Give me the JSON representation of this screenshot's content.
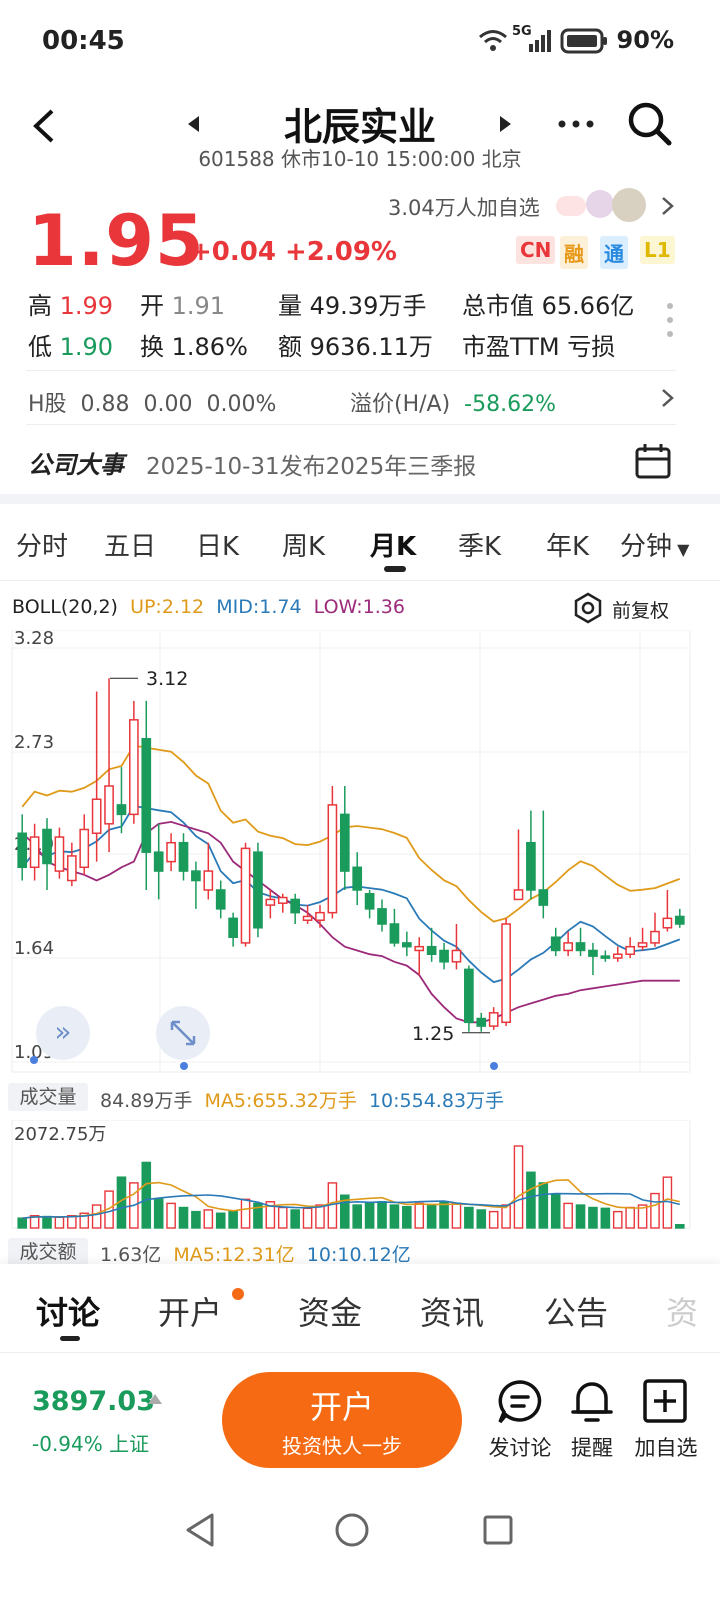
{
  "status": {
    "time": "00:45",
    "network": "5G",
    "battery": "90%"
  },
  "header": {
    "title": "北辰实业",
    "code": "601588",
    "market_status": "休市10-10 15:00:00 北京"
  },
  "quote": {
    "price": "1.95",
    "change": "+0.04",
    "change_pct": "+2.09%",
    "watchers": "3.04万人加自选",
    "tags": [
      "CN",
      "融",
      "通",
      "L1"
    ],
    "high_label": "高",
    "high": "1.99",
    "open_label": "开",
    "open": "1.91",
    "volume_label": "量",
    "volume": "49.39万手",
    "mcap_label": "总市值",
    "mcap": "65.66亿",
    "low_label": "低",
    "low": "1.90",
    "turnover_label": "换",
    "turnover": "1.86%",
    "amount_label": "额",
    "amount": "9636.11万",
    "pe_label": "市盈TTM",
    "pe": "亏损"
  },
  "hshare": {
    "label": "H股",
    "price": "0.88",
    "change": "0.00",
    "pct": "0.00%",
    "premium_label": "溢价(H/A)",
    "premium": "-58.62%"
  },
  "event": {
    "label": "公司大事",
    "text": "2025-10-31发布2025年三季报"
  },
  "period_tabs": [
    "分时",
    "五日",
    "日K",
    "周K",
    "月K",
    "季K",
    "年K",
    "分钟"
  ],
  "active_period": "月K",
  "indicator": {
    "name": "BOLL(20,2)",
    "up": "UP:2.12",
    "mid": "MID:1.74",
    "low": "LOW:1.36",
    "adjust": "前复权"
  },
  "colors": {
    "up": "#e8363b",
    "down": "#1a9b5c",
    "upper": "#e09a1a",
    "mid": "#2a7ab8",
    "lower": "#9b2a7a",
    "accent": "#f56a13"
  },
  "chart_data": {
    "type": "candlestick",
    "y_ticks": [
      "3.28",
      "2.73",
      "2.19",
      "1.64",
      "1.09"
    ],
    "ylim": [
      1.09,
      3.28
    ],
    "max_label": "3.12",
    "min_label": "1.25",
    "candles": [
      {
        "o": 2.3,
        "c": 2.12,
        "h": 2.4,
        "l": 2.05
      },
      {
        "o": 2.12,
        "c": 2.28,
        "h": 2.35,
        "l": 2.05
      },
      {
        "o": 2.32,
        "c": 2.14,
        "h": 2.38,
        "l": 2.0
      },
      {
        "o": 2.1,
        "c": 2.28,
        "h": 2.33,
        "l": 2.06
      },
      {
        "o": 2.05,
        "c": 2.18,
        "h": 2.25,
        "l": 2.02
      },
      {
        "o": 2.12,
        "c": 2.32,
        "h": 2.4,
        "l": 2.08
      },
      {
        "o": 2.3,
        "c": 2.48,
        "h": 3.05,
        "l": 2.15
      },
      {
        "o": 2.35,
        "c": 2.55,
        "h": 3.12,
        "l": 2.2
      },
      {
        "o": 2.45,
        "c": 2.4,
        "h": 2.65,
        "l": 2.3
      },
      {
        "o": 2.4,
        "c": 2.9,
        "h": 3.0,
        "l": 2.35
      },
      {
        "o": 2.8,
        "c": 2.2,
        "h": 3.0,
        "l": 2.0
      },
      {
        "o": 2.2,
        "c": 2.1,
        "h": 2.35,
        "l": 1.95
      },
      {
        "o": 2.15,
        "c": 2.25,
        "h": 2.3,
        "l": 2.1
      },
      {
        "o": 2.25,
        "c": 2.1,
        "h": 2.3,
        "l": 2.05
      },
      {
        "o": 2.1,
        "c": 2.05,
        "h": 2.15,
        "l": 1.9
      },
      {
        "o": 2.0,
        "c": 2.1,
        "h": 2.25,
        "l": 1.95
      },
      {
        "o": 2.0,
        "c": 1.9,
        "h": 2.05,
        "l": 1.85
      },
      {
        "o": 1.85,
        "c": 1.75,
        "h": 1.88,
        "l": 1.7
      },
      {
        "o": 1.72,
        "c": 2.22,
        "h": 2.25,
        "l": 1.7
      },
      {
        "o": 2.2,
        "c": 1.8,
        "h": 2.25,
        "l": 1.75
      },
      {
        "o": 1.92,
        "c": 1.95,
        "h": 2.0,
        "l": 1.85
      },
      {
        "o": 1.93,
        "c": 1.96,
        "h": 1.98,
        "l": 1.88
      },
      {
        "o": 1.95,
        "c": 1.88,
        "h": 1.98,
        "l": 1.82
      },
      {
        "o": 1.84,
        "c": 1.86,
        "h": 1.92,
        "l": 1.82
      },
      {
        "o": 1.84,
        "c": 1.88,
        "h": 1.92,
        "l": 1.8
      },
      {
        "o": 1.88,
        "c": 2.45,
        "h": 2.55,
        "l": 1.85
      },
      {
        "o": 2.4,
        "c": 2.1,
        "h": 2.55,
        "l": 2.0
      },
      {
        "o": 2.12,
        "c": 2.0,
        "h": 2.2,
        "l": 1.92
      },
      {
        "o": 1.98,
        "c": 1.9,
        "h": 2.0,
        "l": 1.85
      },
      {
        "o": 1.9,
        "c": 1.82,
        "h": 1.95,
        "l": 1.78
      },
      {
        "o": 1.82,
        "c": 1.72,
        "h": 1.9,
        "l": 1.7
      },
      {
        "o": 1.72,
        "c": 1.7,
        "h": 1.78,
        "l": 1.65
      },
      {
        "o": 1.68,
        "c": 1.7,
        "h": 1.75,
        "l": 1.55
      },
      {
        "o": 1.7,
        "c": 1.66,
        "h": 1.8,
        "l": 1.62
      },
      {
        "o": 1.68,
        "c": 1.62,
        "h": 1.72,
        "l": 1.58
      },
      {
        "o": 1.62,
        "c": 1.68,
        "h": 1.82,
        "l": 1.58
      },
      {
        "o": 1.58,
        "c": 1.3,
        "h": 1.6,
        "l": 1.25
      },
      {
        "o": 1.32,
        "c": 1.28,
        "h": 1.35,
        "l": 1.25
      },
      {
        "o": 1.28,
        "c": 1.35,
        "h": 1.38,
        "l": 1.26
      },
      {
        "o": 1.3,
        "c": 1.82,
        "h": 1.85,
        "l": 1.28
      },
      {
        "o": 1.95,
        "c": 2.0,
        "h": 2.32,
        "l": 1.95
      },
      {
        "o": 2.25,
        "c": 2.0,
        "h": 2.42,
        "l": 1.95
      },
      {
        "o": 2.0,
        "c": 1.92,
        "h": 2.42,
        "l": 1.85
      },
      {
        "o": 1.75,
        "c": 1.68,
        "h": 1.8,
        "l": 1.65
      },
      {
        "o": 1.68,
        "c": 1.72,
        "h": 1.78,
        "l": 1.65
      },
      {
        "o": 1.72,
        "c": 1.68,
        "h": 1.8,
        "l": 1.65
      },
      {
        "o": 1.68,
        "c": 1.65,
        "h": 1.72,
        "l": 1.55
      },
      {
        "o": 1.65,
        "c": 1.64,
        "h": 1.68,
        "l": 1.62
      },
      {
        "o": 1.64,
        "c": 1.66,
        "h": 1.7,
        "l": 1.62
      },
      {
        "o": 1.66,
        "c": 1.7,
        "h": 1.75,
        "l": 1.64
      },
      {
        "o": 1.7,
        "c": 1.72,
        "h": 1.8,
        "l": 1.68
      },
      {
        "o": 1.72,
        "c": 1.78,
        "h": 1.88,
        "l": 1.7
      },
      {
        "o": 1.8,
        "c": 1.85,
        "h": 2.0,
        "l": 1.78
      },
      {
        "o": 1.86,
        "c": 1.82,
        "h": 1.9,
        "l": 1.8
      }
    ],
    "upper": [
      2.3,
      2.24,
      2.15,
      2.12,
      2.1,
      2.08,
      2.05,
      2.08,
      2.12,
      2.15,
      2.3,
      2.35,
      2.36,
      2.34,
      2.32,
      2.3,
      2.25,
      2.15,
      2.1,
      2.05,
      2.0,
      1.95,
      1.92,
      1.88,
      1.82,
      1.75,
      1.7,
      1.68,
      1.66,
      1.65,
      1.62,
      1.6,
      1.55,
      1.45,
      1.38,
      1.32,
      1.3,
      1.3,
      1.32,
      1.35,
      1.38,
      1.4,
      1.42,
      1.44,
      1.45,
      1.47,
      1.48,
      1.49,
      1.5,
      1.51,
      1.52,
      1.52,
      1.52,
      1.52
    ]
  },
  "volume": {
    "label": "成交量",
    "value": "84.89万手",
    "ma5": "MA5:655.32万手",
    "ma10": "10:554.83万手",
    "max_tick": "2072.75万",
    "bars": [
      0.12,
      0.15,
      0.14,
      0.13,
      0.15,
      0.18,
      0.28,
      0.45,
      0.62,
      0.55,
      0.8,
      0.35,
      0.3,
      0.25,
      0.2,
      0.22,
      0.18,
      0.2,
      0.35,
      0.3,
      0.32,
      0.25,
      0.22,
      0.24,
      0.28,
      0.55,
      0.4,
      0.28,
      0.3,
      0.32,
      0.28,
      0.26,
      0.3,
      0.28,
      0.32,
      0.3,
      0.25,
      0.22,
      0.2,
      0.28,
      1.0,
      0.68,
      0.55,
      0.4,
      0.3,
      0.28,
      0.25,
      0.24,
      0.2,
      0.25,
      0.28,
      0.42,
      0.62,
      0.04
    ],
    "amount_label": "成交额",
    "amount": "1.63亿",
    "amount_ma5": "MA5:12.31亿",
    "amount_ma10": "10:10.12亿"
  },
  "bottom_tabs": [
    "讨论",
    "开户",
    "资金",
    "资讯",
    "公告",
    "资"
  ],
  "bottom_bar": {
    "index_value": "3897.03",
    "index_change": "-0.94% 上证",
    "open_button": "开户",
    "open_sub": "投资快人一步",
    "actions": [
      "发讨论",
      "提醒",
      "加自选"
    ]
  }
}
